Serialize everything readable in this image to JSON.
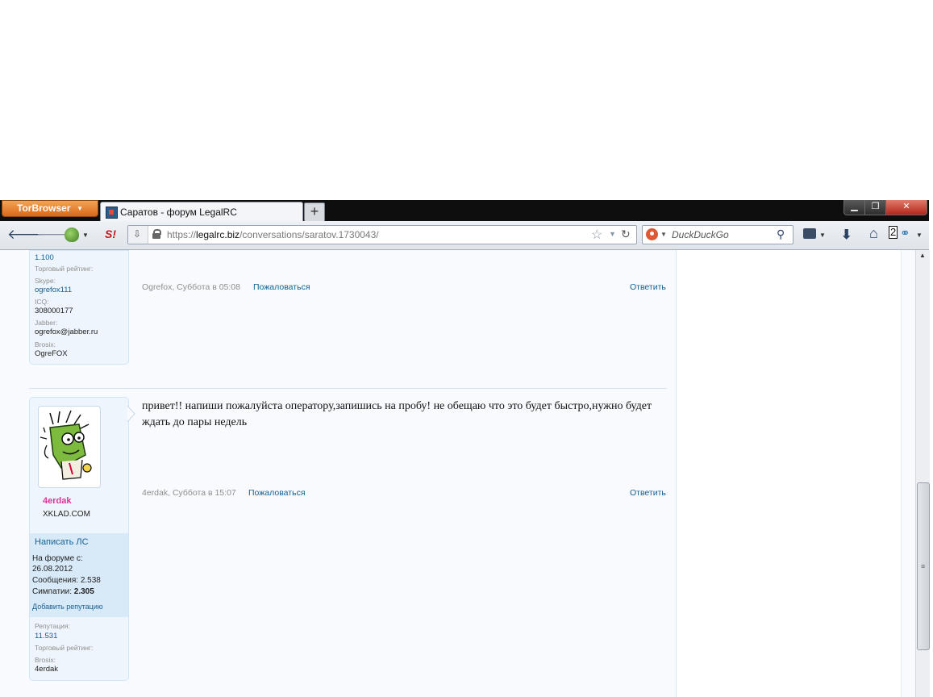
{
  "browser": {
    "menu_button": "TorBrowser",
    "tab_title": "Саратов - форум LegalRC",
    "new_tab": "+",
    "url_scheme": "https://",
    "url_host": "legalrc.biz",
    "url_path": "/conversations/saratov.1730043/",
    "search_placeholder": "DuckDuckGo",
    "badge_count": "2",
    "window_controls": {
      "minimize": "▁",
      "maximize": "❐",
      "close": "✕"
    }
  },
  "post1": {
    "sidebar": {
      "top_value": "1.100",
      "trade_rating_label": "Торговый рейтинг:",
      "skype_label": "Skype:",
      "skype_value": "ogrefox111",
      "icq_label": "ICQ:",
      "icq_value": "308000177",
      "jabber_label": "Jabber:",
      "jabber_value": "ogrefox@jabber.ru",
      "brosix_label": "Brosix:",
      "brosix_value": "OgreFOX"
    },
    "meta": "Ogrefox, Суббота в 05:08",
    "report": "Пожаловаться",
    "reply": "Ответить"
  },
  "post2": {
    "username": "4erdak",
    "user_title": "XKLAD.COM",
    "pm_link": "Написать ЛС",
    "joined_label": "На форуме с:",
    "joined_value": "26.08.2012",
    "messages_label": "Сообщения:",
    "messages_value": "2.538",
    "likes_label": "Симпатии:",
    "likes_value": "2.305",
    "add_rep": "Добавить репутацию",
    "rep_label": "Репутация:",
    "rep_value": "11.531",
    "trade_rating_label": "Торговый рейтинг:",
    "brosix_label": "Brosix:",
    "brosix_value": "4erdak",
    "text": "привет!! напиши пожалуйста оператору,запишись на пробу! не обещаю что это будет быстро,нужно будет ждать до пары недель",
    "meta": "4erdak, Суббота в 15:07",
    "report": "Пожаловаться",
    "reply": "Ответить"
  }
}
